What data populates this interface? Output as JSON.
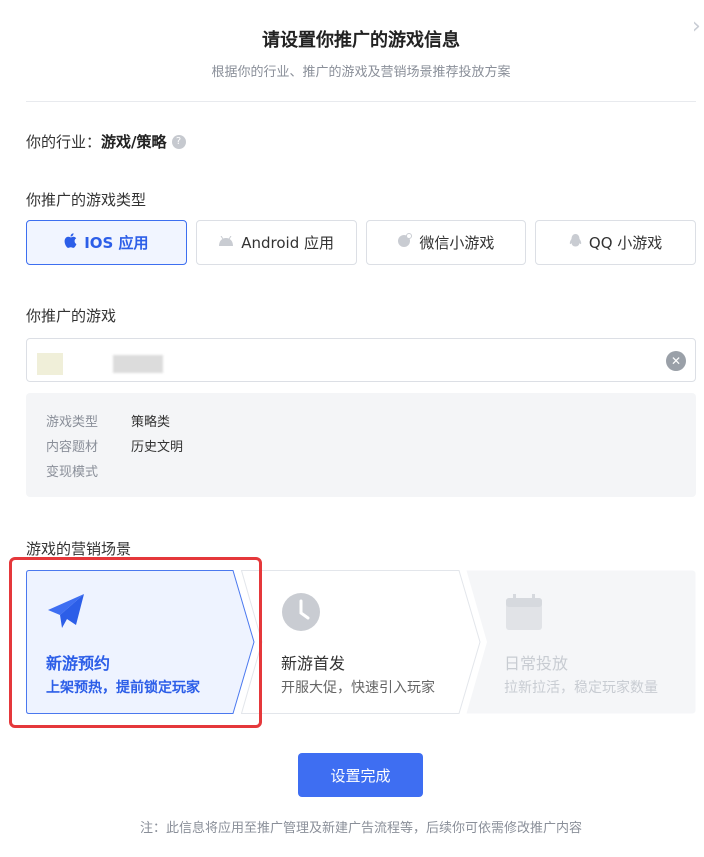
{
  "header": {
    "title": "请设置你推广的游戏信息",
    "subtitle": "根据你的行业、推广的游戏及营销场景推荐投放方案",
    "close_icon": "close-icon"
  },
  "industry": {
    "label": "你的行业：",
    "value": "游戏/策略",
    "help_icon": "question-circle-icon"
  },
  "game_type": {
    "label": "你推广的游戏类型",
    "options": [
      {
        "label": "IOS 应用",
        "icon": "apple-icon",
        "selected": true
      },
      {
        "label": "Android 应用",
        "icon": "android-icon",
        "selected": false
      },
      {
        "label": "微信小游戏",
        "icon": "wechat-minigame-icon",
        "selected": false
      },
      {
        "label": "QQ 小游戏",
        "icon": "qq-icon",
        "selected": false
      }
    ]
  },
  "game": {
    "label": "你推广的游戏",
    "clear_icon": "clear-icon",
    "details": [
      {
        "key": "游戏类型",
        "value": "策略类"
      },
      {
        "key": "内容题材",
        "value": "历史文明"
      },
      {
        "key": "变现模式",
        "value": ""
      }
    ]
  },
  "scene": {
    "label": "游戏的营销场景",
    "options": [
      {
        "title": "新游预约",
        "desc": "上架预热，提前锁定玩家",
        "icon": "paper-plane-icon",
        "state": "selected"
      },
      {
        "title": "新游首发",
        "desc": "开服大促，快速引入玩家",
        "icon": "clock-icon",
        "state": "normal"
      },
      {
        "title": "日常投放",
        "desc": "拉新拉活，稳定玩家数量",
        "icon": "calendar-icon",
        "state": "disabled"
      }
    ]
  },
  "footer": {
    "done_label": "设置完成",
    "note": "注：此信息将应用至推广管理及新建广告流程等，后续你可依需修改推广内容"
  },
  "colors": {
    "primary": "#3e6ef2",
    "highlight_border": "#e5383b"
  }
}
